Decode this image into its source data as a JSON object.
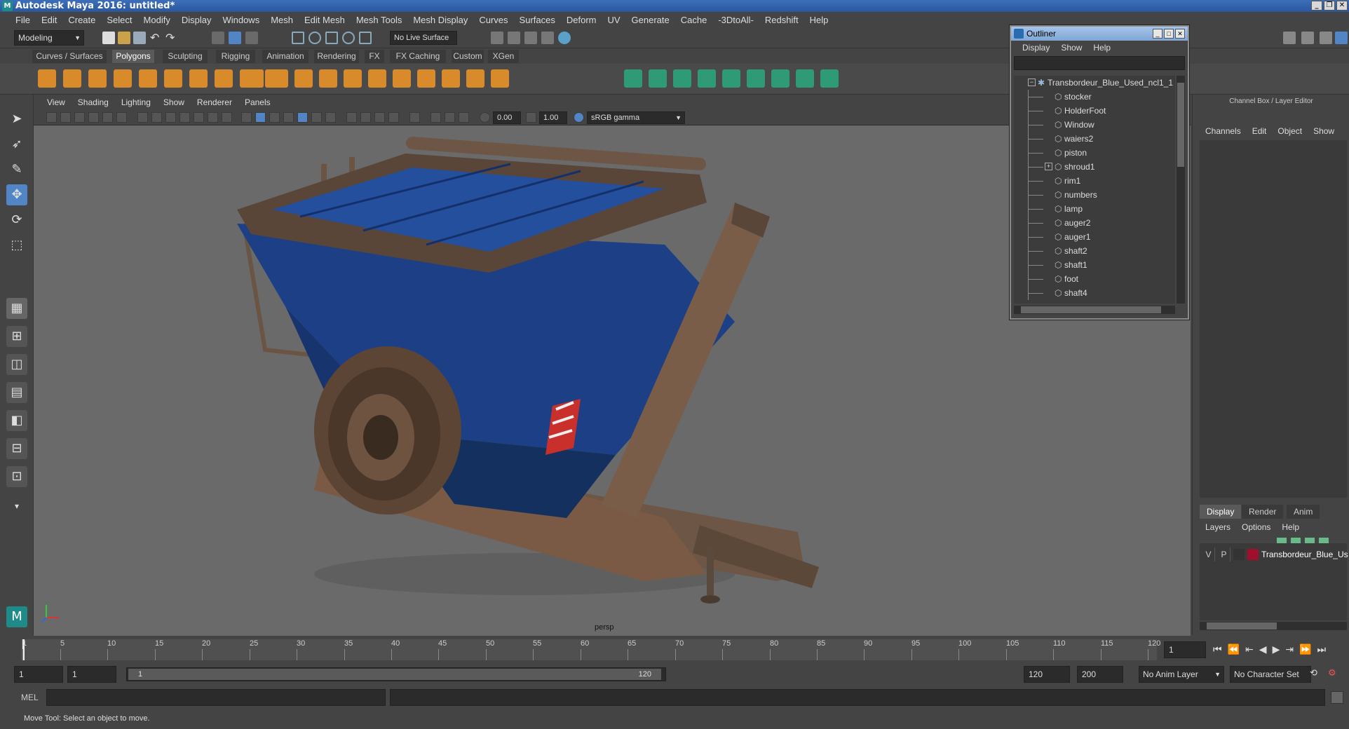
{
  "window": {
    "title": "Autodesk Maya 2016: untitled*"
  },
  "menubar": [
    "File",
    "Edit",
    "Create",
    "Select",
    "Modify",
    "Display",
    "Windows",
    "Mesh",
    "Edit Mesh",
    "Mesh Tools",
    "Mesh Display",
    "Curves",
    "Surfaces",
    "Deform",
    "UV",
    "Generate",
    "Cache",
    "-3DtoAll-",
    "Redshift",
    "Help"
  ],
  "statusline": {
    "menuset": "Modeling",
    "live_surface": "No Live Surface"
  },
  "shelf_tabs": [
    "Curves / Surfaces",
    "Polygons",
    "Sculpting",
    "Rigging",
    "Animation",
    "Rendering",
    "FX",
    "FX Caching",
    "Custom",
    "XGen"
  ],
  "shelf_active": "Polygons",
  "viewport": {
    "menu": [
      "View",
      "Shading",
      "Lighting",
      "Show",
      "Renderer",
      "Panels"
    ],
    "exposure": "0.00",
    "gamma": "1.00",
    "colorspace": "sRGB gamma",
    "camera": "persp"
  },
  "outliner": {
    "title": "Outliner",
    "menu": [
      "Display",
      "Show",
      "Help"
    ],
    "root": "Transbordeur_Blue_Used_ncl1_1",
    "items": [
      "stocker",
      "HolderFoot",
      "Window",
      "waiers2",
      "piston",
      "shroud1",
      "rim1",
      "numbers",
      "lamp",
      "auger2",
      "auger1",
      "shaft2",
      "shaft1",
      "foot",
      "shaft4"
    ]
  },
  "channelbox": {
    "header": "Channel Box / Layer Editor",
    "menu": [
      "Channels",
      "Edit",
      "Object",
      "Show"
    ],
    "layer_tabs": [
      "Display",
      "Render",
      "Anim"
    ],
    "layer_menu": [
      "Layers",
      "Options",
      "Help"
    ],
    "layer": {
      "v": "V",
      "p": "P",
      "name": "Transbordeur_Blue_Us",
      "color": "#a0102a"
    }
  },
  "timeline": {
    "ticks": [
      "1",
      "5",
      "10",
      "15",
      "20",
      "25",
      "30",
      "35",
      "40",
      "45",
      "50",
      "55",
      "60",
      "65",
      "70",
      "75",
      "80",
      "85",
      "90",
      "95",
      "100",
      "105",
      "110",
      "115",
      "120"
    ],
    "current_frame": "1"
  },
  "range": {
    "start": "1",
    "playback_start": "1",
    "slider_start": "1",
    "slider_end": "120",
    "playback_end": "120",
    "end": "200",
    "anim_layer": "No Anim Layer",
    "char_set": "No Character Set"
  },
  "cmdline": {
    "label": "MEL"
  },
  "helpline": {
    "text": "Move Tool: Select an object to move."
  },
  "colors": {
    "accent": "#5285c5",
    "bg": "#444444",
    "viewport": "#6a6a6a",
    "hopper": "#1c3f86",
    "rust": "#7a5a45"
  }
}
